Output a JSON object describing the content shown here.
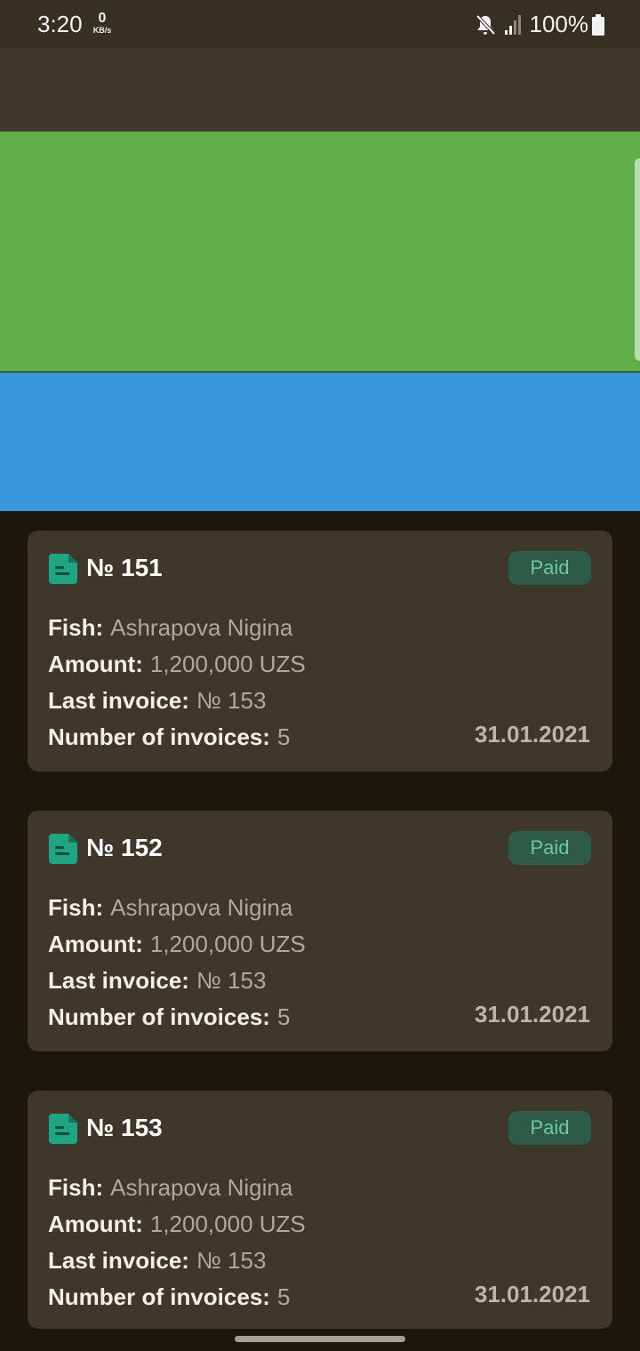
{
  "status_bar": {
    "time": "3:20",
    "net_speed_value": "0",
    "net_speed_unit": "KB/s",
    "battery": "100%",
    "icons": [
      "mute-icon",
      "signal-icon",
      "battery-icon"
    ]
  },
  "colors": {
    "app_bar": "#403a2d",
    "green_panel": "#5fae49",
    "blue_panel": "#3898db",
    "card_background": "#3f372c",
    "paid_badge": "#2e5a48",
    "paid_text": "#6fc8a3",
    "doc_icon": "#1fa584"
  },
  "labels": {
    "fish": "Fish:",
    "amount": "Amount:",
    "last_invoice": "Last invoice:",
    "number_of_invoices": "Number of invoices:"
  },
  "cards": [
    {
      "number": "№ 151",
      "status": "Paid",
      "fish": "Ashrapova Nigina",
      "amount": "1,200,000 UZS",
      "last_invoice": "№ 153",
      "number_of_invoices": "5",
      "date": "31.01.2021"
    },
    {
      "number": "№ 152",
      "status": "Paid",
      "fish": "Ashrapova Nigina",
      "amount": "1,200,000 UZS",
      "last_invoice": "№ 153",
      "number_of_invoices": "5",
      "date": "31.01.2021"
    },
    {
      "number": "№ 153",
      "status": "Paid",
      "fish": "Ashrapova Nigina",
      "amount": "1,200,000 UZS",
      "last_invoice": "№ 153",
      "number_of_invoices": "5",
      "date": "31.01.2021"
    }
  ]
}
